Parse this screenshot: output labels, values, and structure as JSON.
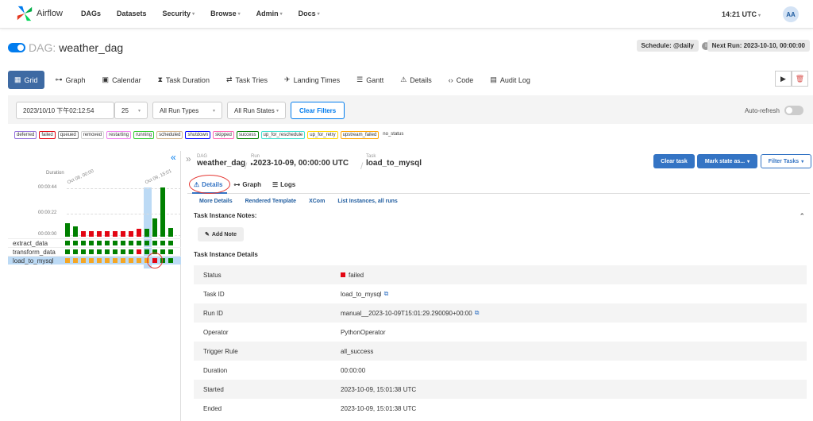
{
  "brand": {
    "name": "Airflow"
  },
  "nav": {
    "items": [
      {
        "label": "DAGs",
        "dropdown": false
      },
      {
        "label": "Datasets",
        "dropdown": false
      },
      {
        "label": "Security",
        "dropdown": true
      },
      {
        "label": "Browse",
        "dropdown": true
      },
      {
        "label": "Admin",
        "dropdown": true
      },
      {
        "label": "Docs",
        "dropdown": true
      }
    ],
    "clock": "14:21 UTC",
    "avatar": "AA"
  },
  "dag": {
    "label": "DAG:",
    "name": "weather_dag",
    "schedule": "Schedule: @daily",
    "next_run": "Next Run: 2023-10-10, 00:00:00"
  },
  "view_tabs": [
    "Grid",
    "Graph",
    "Calendar",
    "Task Duration",
    "Task Tries",
    "Landing Times",
    "Gantt",
    "Details",
    "Code",
    "Audit Log"
  ],
  "filters": {
    "date": "2023/10/10 下午02:12:54",
    "limit": "25",
    "run_types": "All Run Types",
    "run_states": "All Run States",
    "clear": "Clear Filters",
    "auto_refresh": "Auto-refresh"
  },
  "legend": [
    {
      "label": "deferred",
      "color": "#9370db"
    },
    {
      "label": "failed",
      "color": "#e30613"
    },
    {
      "label": "queued",
      "color": "#808080"
    },
    {
      "label": "removed",
      "color": "#d3d3d3"
    },
    {
      "label": "restarting",
      "color": "#ee82ee"
    },
    {
      "label": "running",
      "color": "#32cd32"
    },
    {
      "label": "scheduled",
      "color": "#d2b48c"
    },
    {
      "label": "shutdown",
      "color": "#0000ff"
    },
    {
      "label": "skipped",
      "color": "#ff69b4"
    },
    {
      "label": "success",
      "color": "#008000"
    },
    {
      "label": "up_for_reschedule",
      "color": "#40e0d0"
    },
    {
      "label": "up_for_retry",
      "color": "#ffd700"
    },
    {
      "label": "upstream_failed",
      "color": "#ffa500"
    },
    {
      "label": "no_status",
      "color": "#ffffff"
    }
  ],
  "grid": {
    "duration_label": "Duration",
    "ticks": [
      "00:00:44",
      "00:00:22",
      "00:00:00"
    ],
    "dates": [
      "Oct 08, 00:00",
      "Oct 09, 15:01"
    ],
    "run_durations": [
      12,
      9,
      5,
      5,
      5,
      5,
      5,
      5,
      5,
      7,
      7,
      16,
      44,
      8
    ],
    "run_states": [
      "success",
      "success",
      "failed",
      "failed",
      "failed",
      "failed",
      "failed",
      "failed",
      "failed",
      "failed",
      "success",
      "success",
      "success",
      "success"
    ],
    "selected_run": 11,
    "tasks": [
      {
        "name": "extract_data",
        "states": [
          "success",
          "success",
          "success",
          "success",
          "success",
          "success",
          "success",
          "success",
          "success",
          "success",
          "success",
          "success",
          "success",
          "success"
        ]
      },
      {
        "name": "transform_data",
        "states": [
          "success",
          "success",
          "success",
          "success",
          "success",
          "success",
          "success",
          "success",
          "success",
          "failed",
          "success",
          "success",
          "success",
          "success"
        ]
      },
      {
        "name": "load_to_mysql",
        "states": [
          "upstream_failed",
          "upstream_failed",
          "upstream_failed",
          "upstream_failed",
          "upstream_failed",
          "upstream_failed",
          "upstream_failed",
          "upstream_failed",
          "upstream_failed",
          "upstream_failed",
          "upstream_failed",
          "failed",
          "success",
          "success"
        ]
      }
    ],
    "selected_task": 2
  },
  "breadcrumb": {
    "dag_label": "DAG",
    "dag_value": "weather_dag",
    "run_label": "Run",
    "run_value": "2023-10-09, 00:00:00 UTC",
    "task_label": "Task",
    "task_value": "load_to_mysql"
  },
  "actions": {
    "clear_task": "Clear task",
    "mark_state": "Mark state as...",
    "filter_tasks": "Filter Tasks"
  },
  "subtabs": [
    "Details",
    "Graph",
    "Logs"
  ],
  "sublinks": [
    "More Details",
    "Rendered Template",
    "XCom",
    "List Instances, all runs"
  ],
  "notes": {
    "title": "Task Instance Notes:",
    "add_note": "Add Note"
  },
  "details": {
    "title": "Task Instance Details",
    "rows": [
      {
        "key": "Status",
        "value": "failed",
        "status": true
      },
      {
        "key": "Task ID",
        "value": "load_to_mysql",
        "copy": true
      },
      {
        "key": "Run ID",
        "value": "manual__2023-10-09T15:01:29.290090+00:00",
        "copy": true
      },
      {
        "key": "Operator",
        "value": "PythonOperator"
      },
      {
        "key": "Trigger Rule",
        "value": "all_success"
      },
      {
        "key": "Duration",
        "value": "00:00:00"
      },
      {
        "key": "Started",
        "value": "2023-10-09, 15:01:38 UTC"
      },
      {
        "key": "Ended",
        "value": "2023-10-09, 15:01:38 UTC"
      }
    ]
  },
  "colors": {
    "success": "#008000",
    "failed": "#e30613",
    "upstream_failed": "#f5a623",
    "accent": "#3474c4"
  }
}
